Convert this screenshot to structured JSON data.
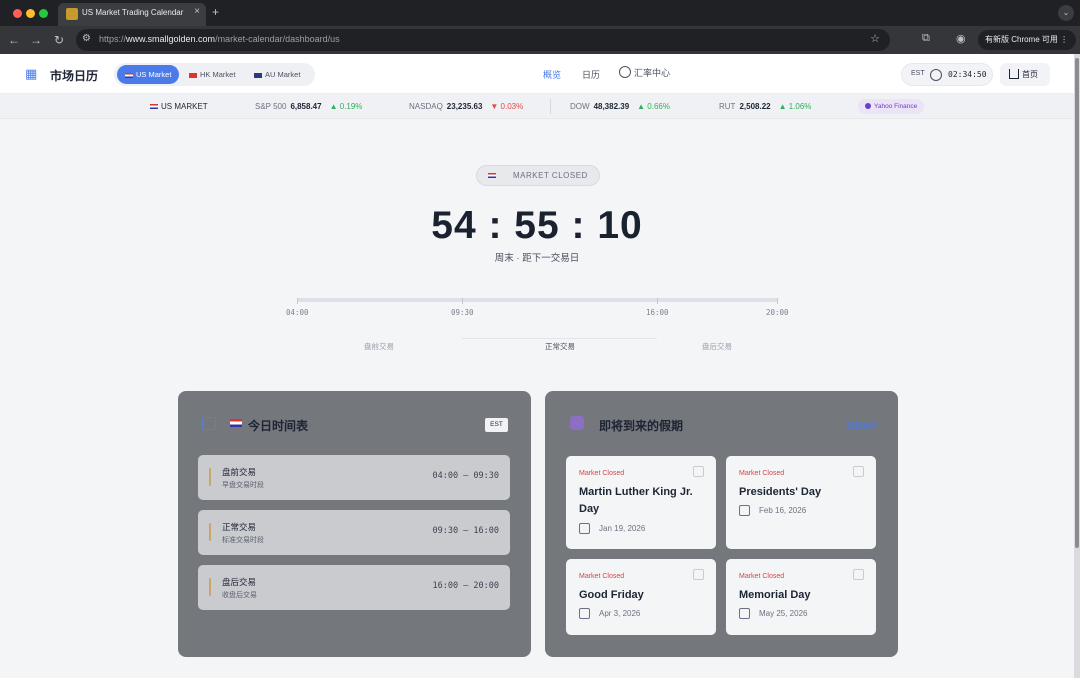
{
  "browser": {
    "tab_title": "US Market Trading Calendar",
    "tab_close": "×",
    "new_tab": "+",
    "tab_menu": "⌄",
    "url_prefix": "https://",
    "url_host": "www.smallgolden.com",
    "url_path": "/market-calendar/dashboard/us",
    "update_label": "有新版 Chrome 可用"
  },
  "header": {
    "logo_text": "市场日历",
    "markets": [
      {
        "label": "US Market",
        "active": true
      },
      {
        "label": "HK Market",
        "active": false
      },
      {
        "label": "AU Market",
        "active": false
      }
    ],
    "nav": [
      {
        "label": "概览",
        "active": true
      },
      {
        "label": "日历",
        "active": false
      },
      {
        "label": "汇率中心",
        "active": false
      }
    ],
    "timezone": "EST",
    "clock_time": "02:34:50",
    "home_label": "首页"
  },
  "ticker": {
    "market_label": "US MARKET",
    "items": [
      {
        "name": "S&P 500",
        "value": "6,858.47",
        "change": "0.19%",
        "direction": "up"
      },
      {
        "name": "NASDAQ",
        "value": "23,235.63",
        "change": "0.03%",
        "direction": "down"
      },
      {
        "name": "DOW",
        "value": "48,382.39",
        "change": "0.66%",
        "direction": "up"
      },
      {
        "name": "RUT",
        "value": "2,508.22",
        "change": "1.06%",
        "direction": "up"
      }
    ],
    "source": "Yahoo Finance"
  },
  "hero": {
    "status": "MARKET CLOSED",
    "countdown": "54 : 55 : 10",
    "subtitle": "周末 · 距下一交易日",
    "timeline_ticks": [
      "04:00",
      "09:30",
      "16:00",
      "20:00"
    ],
    "sessions": [
      "盘前交易",
      "正常交易",
      "盘后交易"
    ]
  },
  "schedule": {
    "title": "今日时间表",
    "timezone_badge": "EST",
    "rows": [
      {
        "name": "盘前交易",
        "desc": "早盘交易时段",
        "time": "04:00 – 09:30"
      },
      {
        "name": "正常交易",
        "desc": "标准交易时段",
        "time": "09:30 – 16:00"
      },
      {
        "name": "盘后交易",
        "desc": "收盘后交易",
        "time": "16:00 – 20:00"
      }
    ]
  },
  "holidays": {
    "title": "即将到来的假期",
    "view_all": "查看全部",
    "items": [
      {
        "status": "Market Closed",
        "name": "Martin Luther King Jr. Day",
        "date": "Jan 19, 2026"
      },
      {
        "status": "Market Closed",
        "name": "Presidents' Day",
        "date": "Feb 16, 2026"
      },
      {
        "status": "Market Closed",
        "name": "Good Friday",
        "date": "Apr 3, 2026"
      },
      {
        "status": "Market Closed",
        "name": "Memorial Day",
        "date": "May 25, 2026"
      }
    ]
  },
  "colors": {
    "accent": "#4a7be8",
    "up": "#2eb15a",
    "down": "#e24a4a",
    "closed": "#d64545"
  }
}
